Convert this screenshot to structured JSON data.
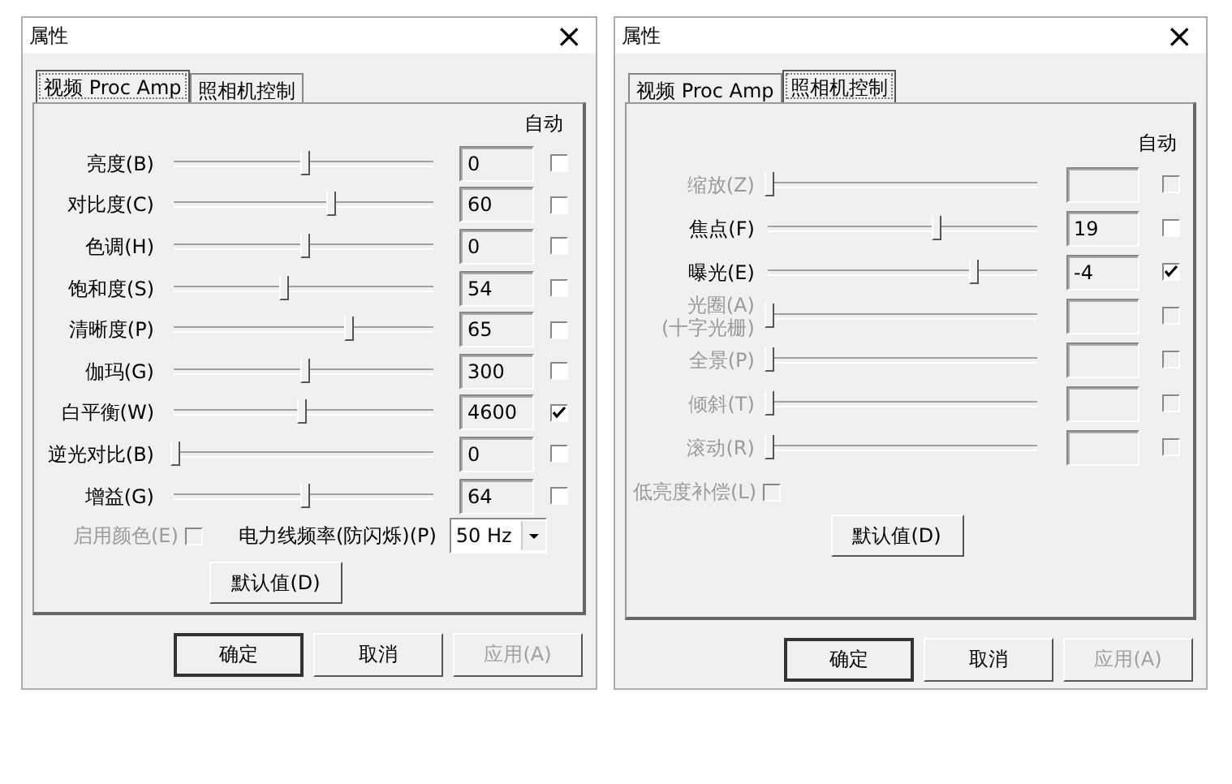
{
  "dialogs": [
    {
      "title": "属性",
      "close": "×",
      "tabs": [
        {
          "label": "视频 Proc Amp",
          "selected": true
        },
        {
          "label": "照相机控制",
          "selected": false
        }
      ],
      "auto_header": "自动",
      "controls": [
        {
          "label": "亮度(B)",
          "level": 0.5,
          "value": "0",
          "auto": false,
          "disabled": false
        },
        {
          "label": "对比度(C)",
          "level": 0.6,
          "value": "60",
          "auto": false,
          "disabled": false
        },
        {
          "label": "色调(H)",
          "level": 0.5,
          "value": "0",
          "auto": false,
          "disabled": false
        },
        {
          "label": "饱和度(S)",
          "level": 0.42,
          "value": "54",
          "auto": false,
          "disabled": false
        },
        {
          "label": "清晰度(P)",
          "level": 0.67,
          "value": "65",
          "auto": false,
          "disabled": false
        },
        {
          "label": "伽玛(G)",
          "level": 0.5,
          "value": "300",
          "auto": false,
          "disabled": false
        },
        {
          "label": "白平衡(W)",
          "level": 0.49,
          "value": "4600",
          "auto": true,
          "disabled": false
        },
        {
          "label": "逆光对比(B)",
          "level": 0,
          "value": "0",
          "auto": false,
          "disabled": false
        },
        {
          "label": "增益(G)",
          "level": 0.5,
          "value": "64",
          "auto": false,
          "disabled": false
        }
      ],
      "options": [
        {
          "kind": "checkbox",
          "label": "启用颜色(E)",
          "checked": false,
          "disabled": true
        },
        {
          "kind": "select",
          "label": "电力线频率(防闪烁)(P)",
          "value": "50 Hz"
        }
      ],
      "default_button": "默认值(D)",
      "buttons": [
        {
          "label": "确定",
          "default": true,
          "disabled": false
        },
        {
          "label": "取消",
          "default": false,
          "disabled": false
        },
        {
          "label": "应用(A)",
          "default": false,
          "disabled": true
        }
      ]
    },
    {
      "title": "属性",
      "close": "×",
      "tabs": [
        {
          "label": "视频 Proc Amp",
          "selected": false
        },
        {
          "label": "照相机控制",
          "selected": true
        }
      ],
      "auto_header": "自动",
      "controls": [
        {
          "label": "缩放(Z)",
          "level": 0,
          "auto": false,
          "disabled": true
        },
        {
          "label": "焦点(F)",
          "level": 0.62,
          "value": "19",
          "auto": false,
          "disabled": false
        },
        {
          "label": "曝光(E)",
          "level": 0.76,
          "value": "-4",
          "auto": true,
          "disabled": false
        },
        {
          "label": "光圈(A)\n(十字光栅)",
          "level": 0,
          "auto": false,
          "disabled": true
        },
        {
          "label": "全景(P)",
          "level": 0,
          "auto": false,
          "disabled": true
        },
        {
          "label": "倾斜(T)",
          "level": 0,
          "auto": false,
          "disabled": true
        },
        {
          "label": "滚动(R)",
          "level": 0,
          "auto": false,
          "disabled": true
        }
      ],
      "options": [
        {
          "kind": "checkbox",
          "label": "低亮度补偿(L)",
          "checked": false,
          "disabled": true
        }
      ],
      "default_button": "默认值(D)",
      "buttons": [
        {
          "label": "确定",
          "default": true,
          "disabled": false
        },
        {
          "label": "取消",
          "default": false,
          "disabled": false
        },
        {
          "label": "应用(A)",
          "default": false,
          "disabled": true
        }
      ]
    }
  ]
}
